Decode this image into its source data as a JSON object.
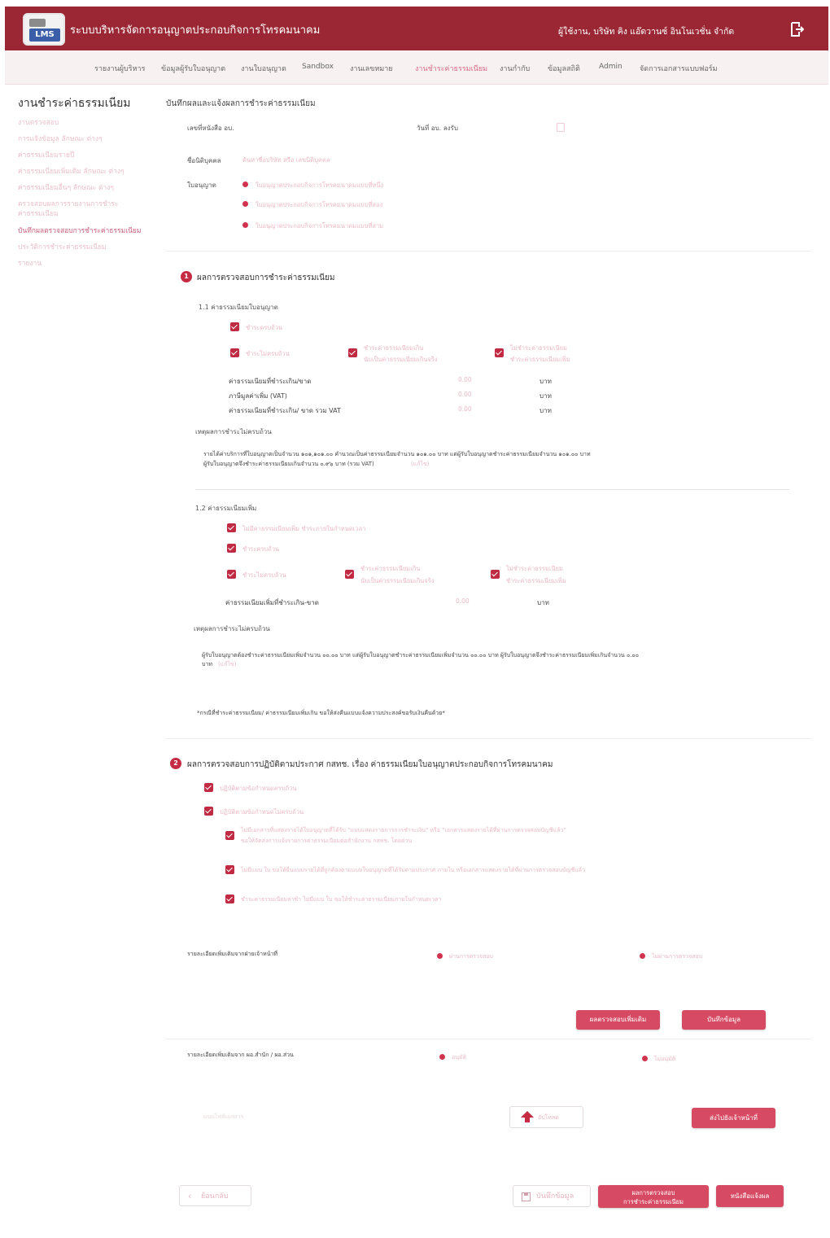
{
  "header": {
    "app_title": "ระบบบริหารจัดการอนุญาตประกอบกิจการโทรคมนาคม",
    "logo_text": "LMS",
    "username": "ผู้ใช้งาน, บริษัท คิง แอ๊ดวานซ์ อินโนเวชั่น จำกัด"
  },
  "nav": {
    "items": [
      "รายงานผู้บริหาร",
      "ข้อมูลผู้รับใบอนุญาต",
      "งานใบอนุญาต",
      "Sandbox",
      "งานเลขหมาย",
      "งานชำระค่าธรรมเนียม",
      "งานกำกับ",
      "ข้อมูลสถิติ",
      "Admin",
      "จัดการเอกสารแบบฟอร์ม"
    ],
    "active_index": 5
  },
  "sidebar": {
    "title": "งานชำระค่าธรรมเนียม",
    "items": [
      "งานตรวจสอบ",
      "การแจ้งข้อมูล ลักษณะ ต่างๆ",
      "ค่าธรรมเนียมรายปี",
      "ค่าธรรมเนียมเพิ่มเติม ลักษณะ ต่างๆ",
      "ค่าธรรมเนียมอื่นๆ ลักษณะ ต่างๆ",
      "ตรวจสอบผลการรายงานการชำระ",
      "ค่าธรรมเนียม",
      "บันทึกผลตรวจสอบการชำระค่าธรรมเนียม",
      "ประวัติการชำระค่าธรรมเนียม",
      "รายงาน"
    ],
    "active_index": 7
  },
  "page": {
    "title": "บันทึกผลและแจ้งผลการชำระค่าธรรมเนียม",
    "doc_no_label": "เลขที่หนังสือ อบ.",
    "doc_date_label": "วันที่ อบ. ลงรับ",
    "person_label": "ชื่อนิติบุคคล",
    "person_value": "ค้นหาชื่อบริษัท หรือ เลขนิติบุคคล",
    "license_label": "ใบอนุญาต",
    "license_options": [
      "ใบอนุญาตประกอบกิจการโทรคมนาคมแบบที่หนึ่ง",
      "ใบอนุญาตประกอบกิจการโทรคมนาคมแบบที่สอง",
      "ใบอนุญาตประกอบกิจการโทรคมนาคมแบบที่สาม"
    ]
  },
  "section1": {
    "number": "1",
    "title": "ผลการตรวจสอบการชำระค่าธรรมเนียม",
    "sub1_title": "1.1 ค่าธรรมเนียมใบอนุญาต",
    "sub1_checks": [
      "ชำระครบถ้วน",
      "ชำระไม่ครบถ้วน",
      "ชำระค่าธรรมเนียมเกิน",
      "ไม่ชำระค่าธรรมเนียม"
    ],
    "sub1_checks_line2": [
      "นับเป็นค่าธรรมเนียมเกินจริง",
      "ชำระค่าธรรมเนียมเพิ่ม"
    ],
    "fee_rows": [
      {
        "label": "ค่าธรรมเนียมที่ชำระเกิน/ขาด",
        "value": "0.00",
        "unit": "บาท"
      },
      {
        "label": "ภาษีมูลค่าเพิ่ม (VAT)",
        "value": "0.00",
        "unit": "บาท"
      },
      {
        "label": "ค่าธรรมเนียมที่ชำระเกิน/ ขาด รวม VAT",
        "value": "0.00",
        "unit": "บาท"
      }
    ],
    "reason_label": "เหตุผลการชำระไม่ครบถ้วน",
    "reason_line1": "รายได้ค่าบริการที่ใบอนุญาตเป็นจำนวน ๑๐๑,๑๐๑.๐๐ คำนวณเป็นค่าธรรมเนียมจำนวน ๑๐๑.๐๐ บาท แต่ผู้รับใบอนุญาตชำระค่าธรรมเนียมจำนวน ๑๐๑.๐๐ บาท",
    "reason_line2": "ผู้รับใบอนุญาตจึงชำระค่าธรรมเนียมเกินจำนวน ๐.๙๖ บาท (รวม VAT)",
    "reason_edit": "(แก้ไข)",
    "sub2_title": "1.2 ค่าธรรมเนียมเพิ่ม",
    "sub2_checks": [
      "ไม่มีค่าธรรมเนียมเพิ่ม ชำระภายในกำหนดเวลา",
      "ชำระครบถ้วน",
      "ชำระไม่ครบถ้วน",
      "ชำระค่าธรรมเนียมเกิน",
      "ไม่ชำระค่าธรรมเนียม"
    ],
    "sub2_checks_line2": [
      "นับเป็นค่าธรรมเนียมเกินจริง",
      "ชำระค่าธรรมเนียมเพิ่ม"
    ],
    "extra_fee_label": "ค่าธรรมเนียมเพิ่มที่ชำระเกิน-ขาด",
    "extra_fee_value": "0.00",
    "extra_fee_unit": "บาท",
    "reason2_label": "เหตุผลการชำระไม่ครบถ้วน",
    "reason2_line1": "ผู้รับใบอนุญาตต้องชำระค่าธรรมเนียมเพิ่มจำนวน ๐๐.๐๐ บาท แต่ผู้รับใบอนุญาตชำระค่าธรรมเนียมเพิ่มจำนวน ๐๐.๐๐ บาท ผู้รับใบอนุญาตจึงชำระค่าธรรมเนียมเพิ่มเกินจำนวน ๐.๐๐",
    "reason2_line2": "บาท",
    "reason2_edit": "(แก้ไข)",
    "note": "*กรณีที่ชำระค่าธรรมเนียม/ ค่าธรรมเนียมเพิ่มเกิน ขอให้ส่งคืนแบบแจ้งความประสงค์ขอรับเงินคืนด้วย*"
  },
  "section2": {
    "number": "2",
    "title": "ผลการตรวจสอบการปฏิบัติตามประกาศ กสทช. เรื่อง ค่าธรรมเนียมใบอนุญาตประกอบกิจการโทรคมนาคม",
    "checks": [
      "ปฏิบัติตามข้อกำหนดครบถ้วน",
      "ปฏิบัติตามข้อกำหนดไม่ครบถ้วน"
    ],
    "sub_line1a": "ไม่มีเอกสารที่แสดงรายได้ใบอนุญาตที่ได้รับ \"แบบแสดงรายการการชำระเงิน\" หรือ \"เอกสารแสดงรายได้ที่ผ่านการตรวจสอบบัญชีแล้ว\"",
    "sub_line1b": "ขอให้จัดส่งการแจ้งรายการค่าธรรมเนียมต่อสำนักงาน กสทช. โดยด่วน",
    "sub_line2": "ไม่มีแบบ ใบ ขอให้ยื่นแบบรายได้ที่ถูกต้องตามแบบใบอนุญาตที่ได้รับตามประกาศ ภายใน หรือเอกสารแสดงรายได้ที่ผ่านการตรวจสอบบัญชีแล้ว",
    "sub_line3": "ชำระค่าธรรมเนียมล่าช้า ไม่มีแบบ ใบ ขอให้ชำระค่าธรรมเนียมภายในกำหนดเวลา"
  },
  "send_row1": {
    "label": "รายละเอียดเพิ่มเติมจากฝ่ายเจ้าหน้าที่",
    "opt1": "ผ่านการตรวจสอบ",
    "opt2": "ไม่ผ่านการตรวจสอบ",
    "btn_review": "ผลตรวจสอบเพิ่มเติม",
    "btn_save": "บันทึกข้อมูล"
  },
  "send_row2": {
    "label": "รายละเอียดเพิ่มเติมจาก ผอ.สำนัก / ผอ.ส่วน",
    "opt1": "อนุมัติ",
    "opt2": "ไม่อนุมัติ",
    "attach_label": "แนบไฟล์เอกสาร",
    "upload_label": "อัปโหลด",
    "btn_send": "ส่งไปยังเจ้าหน้าที่"
  },
  "footer": {
    "back": "ย้อนกลับ",
    "save": "บันทึกข้อมูล",
    "result_line1": "ผลการตรวจสอบ",
    "result_line2": "การชำระค่าธรรมเนียม",
    "send_letter": "หนังสือแจ้งผล"
  },
  "colors": {
    "brand": "#9a2733",
    "accent": "#d74a63",
    "faint_text": "#eab8c5"
  }
}
